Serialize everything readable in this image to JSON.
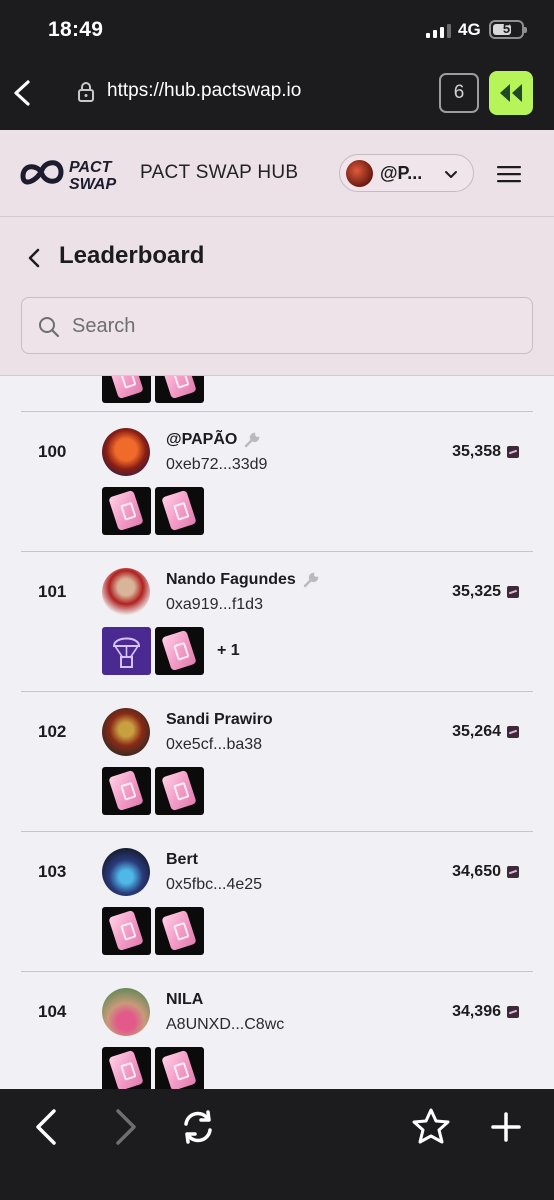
{
  "status_bar": {
    "time": "18:49",
    "network": "4G",
    "battery": "5"
  },
  "browser": {
    "url": "https://hub.pactswap.io",
    "tab_count": "6"
  },
  "site": {
    "logo_text_1": "PACT",
    "logo_text_2": "SWAP",
    "title": "PACT SWAP HUB",
    "user_label": "@P..."
  },
  "page": {
    "title": "Leaderboard",
    "search_placeholder": "Search"
  },
  "rows": [
    {
      "rank": "100",
      "name": "@PAPÃO",
      "address": "0xeb72...33d9",
      "points": "35,358",
      "wrench": true,
      "badges": [
        "card",
        "card"
      ],
      "extra": ""
    },
    {
      "rank": "101",
      "name": "Nando Fagundes",
      "address": "0xa919...f1d3",
      "points": "35,325",
      "wrench": true,
      "badges": [
        "drop",
        "card"
      ],
      "extra": "+ 1"
    },
    {
      "rank": "102",
      "name": "Sandi Prawiro",
      "address": "0xe5cf...ba38",
      "points": "35,264",
      "wrench": false,
      "badges": [
        "card",
        "card"
      ],
      "extra": ""
    },
    {
      "rank": "103",
      "name": "Bert",
      "address": "0x5fbc...4e25",
      "points": "34,650",
      "wrench": false,
      "badges": [
        "card",
        "card"
      ],
      "extra": ""
    },
    {
      "rank": "104",
      "name": "NILA",
      "address": "A8UNXD...C8wc",
      "points": "34,396",
      "wrench": false,
      "badges": [
        "card",
        "card"
      ],
      "extra": ""
    }
  ],
  "colors": {
    "accent": "#b7f45a",
    "header_bg": "#ece1e7",
    "chrome_bg": "#1c1c1e",
    "page_bg": "#f1f0f4"
  }
}
